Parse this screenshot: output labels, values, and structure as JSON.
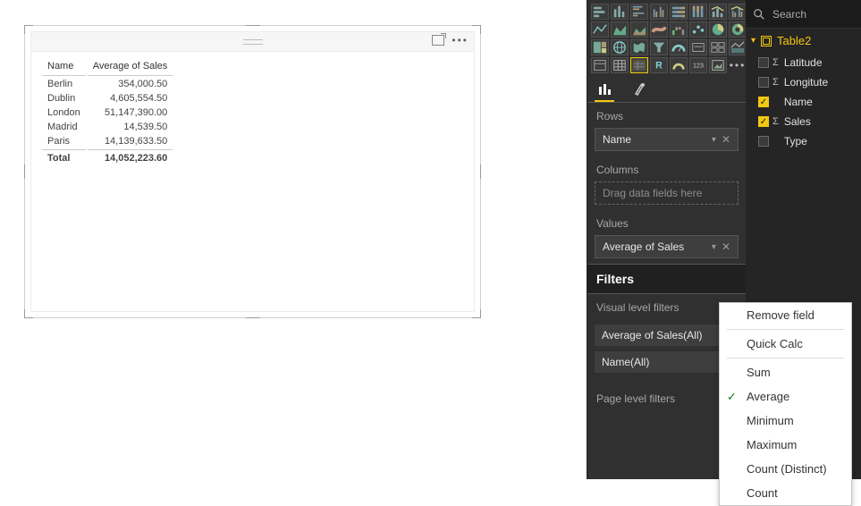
{
  "chart_data": {
    "type": "table",
    "columns": [
      "Name",
      "Average of Sales"
    ],
    "rows": [
      [
        "Berlin",
        354000.5
      ],
      [
        "Dublin",
        4605554.5
      ],
      [
        "London",
        51147390.0
      ],
      [
        "Madrid",
        14539.5
      ],
      [
        "Paris",
        14139633.5
      ]
    ],
    "total": [
      "Total",
      14052223.6
    ]
  },
  "table": {
    "col1": "Name",
    "col2": "Average of Sales",
    "rows": [
      {
        "name": "Berlin",
        "val": "354,000.50"
      },
      {
        "name": "Dublin",
        "val": "4,605,554.50"
      },
      {
        "name": "London",
        "val": "51,147,390.00"
      },
      {
        "name": "Madrid",
        "val": "14,539.50"
      },
      {
        "name": "Paris",
        "val": "14,139,633.50"
      }
    ],
    "total_label": "Total",
    "total_val": "14,052,223.60"
  },
  "viz": {
    "section_rows": "Rows",
    "section_columns": "Columns",
    "section_values": "Values",
    "rows_field": "Name",
    "columns_placeholder": "Drag data fields here",
    "values_field": "Average of Sales",
    "filters_header": "Filters",
    "visual_filters_label": "Visual level filters",
    "filter1": "Average of Sales(All)",
    "filter2": "Name(All)",
    "page_filters_label": "Page level filters"
  },
  "ctx": {
    "remove": "Remove field",
    "quick": "Quick Calc",
    "sum": "Sum",
    "avg": "Average",
    "min": "Minimum",
    "max": "Maximum",
    "countd": "Count (Distinct)",
    "count": "Count"
  },
  "fields": {
    "search": "Search",
    "table_name": "Table2",
    "items": [
      {
        "label": "Latitude",
        "checked": false,
        "sigma": true
      },
      {
        "label": "Longitute",
        "checked": false,
        "sigma": true
      },
      {
        "label": "Name",
        "checked": true,
        "sigma": false
      },
      {
        "label": "Sales",
        "checked": true,
        "sigma": true
      },
      {
        "label": "Type",
        "checked": false,
        "sigma": false
      }
    ]
  }
}
